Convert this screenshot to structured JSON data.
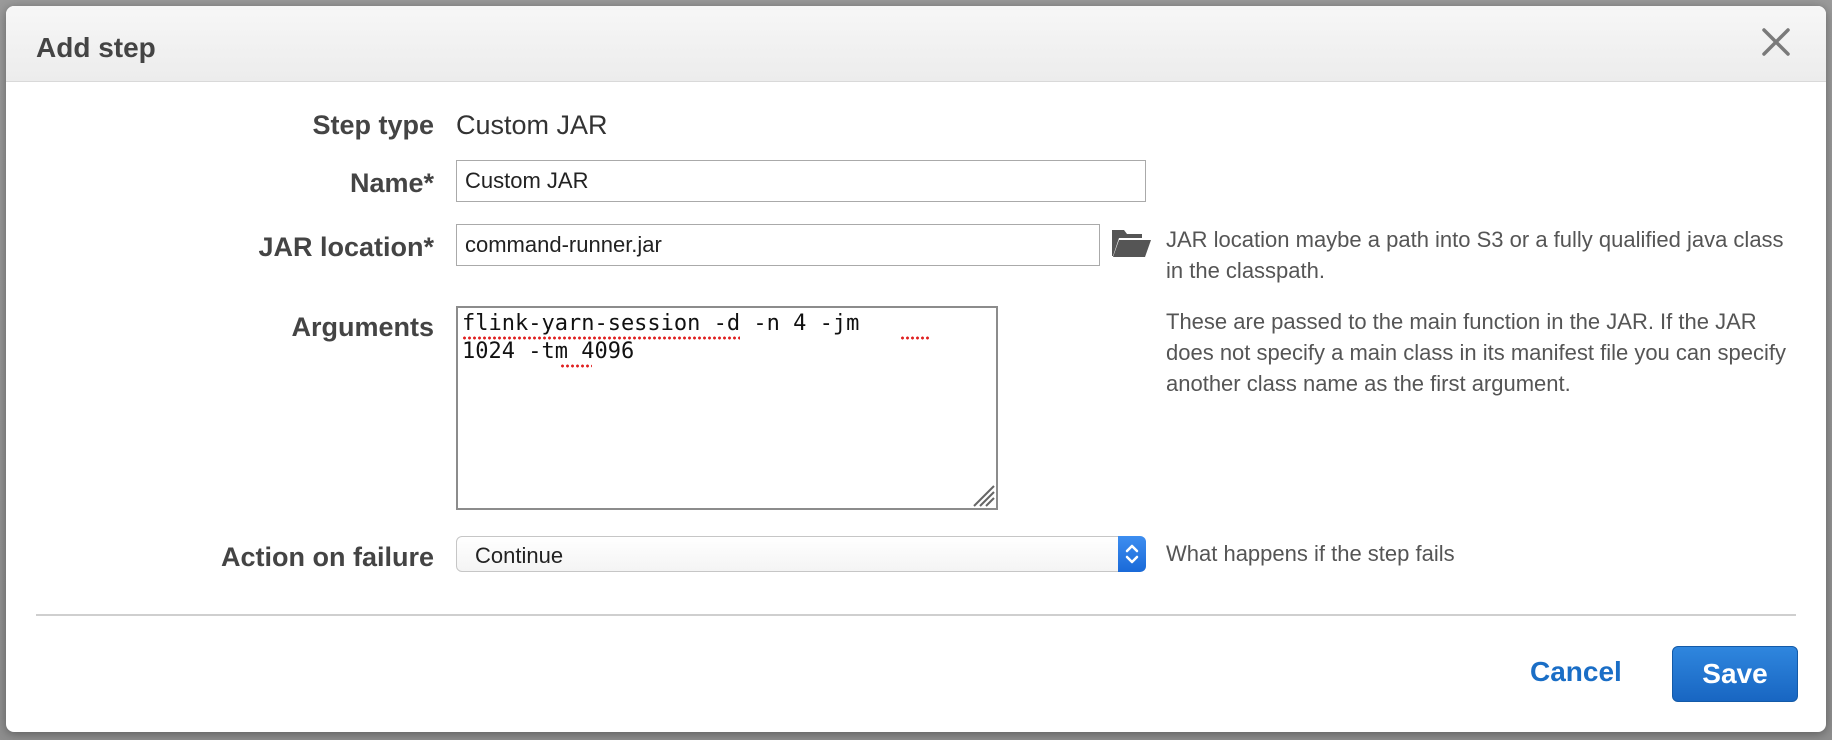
{
  "dialog": {
    "title": "Add step",
    "close_icon": "close-icon"
  },
  "form": {
    "step_type": {
      "label": "Step type",
      "value": "Custom JAR"
    },
    "name": {
      "label": "Name*",
      "value": "Custom JAR"
    },
    "jar_location": {
      "label": "JAR location*",
      "value": "command-runner.jar",
      "browse_icon": "folder-open-icon",
      "help": "JAR location maybe a path into S3 or a fully qualified java class in the classpath."
    },
    "arguments": {
      "label": "Arguments",
      "value": "flink-yarn-session -d -n 4 -jm\n1024 -tm 4096",
      "help": "These are passed to the main function in the JAR. If the JAR does not specify a main class in its manifest file you can specify another class name as the first argument."
    },
    "action_on_failure": {
      "label": "Action on failure",
      "selected": "Continue",
      "help": "What happens if the step fails"
    }
  },
  "footer": {
    "cancel_label": "Cancel",
    "save_label": "Save"
  },
  "colors": {
    "accent": "#1a6ec6",
    "primary_button": "#1866c2",
    "spellcheck": "#e02020"
  }
}
